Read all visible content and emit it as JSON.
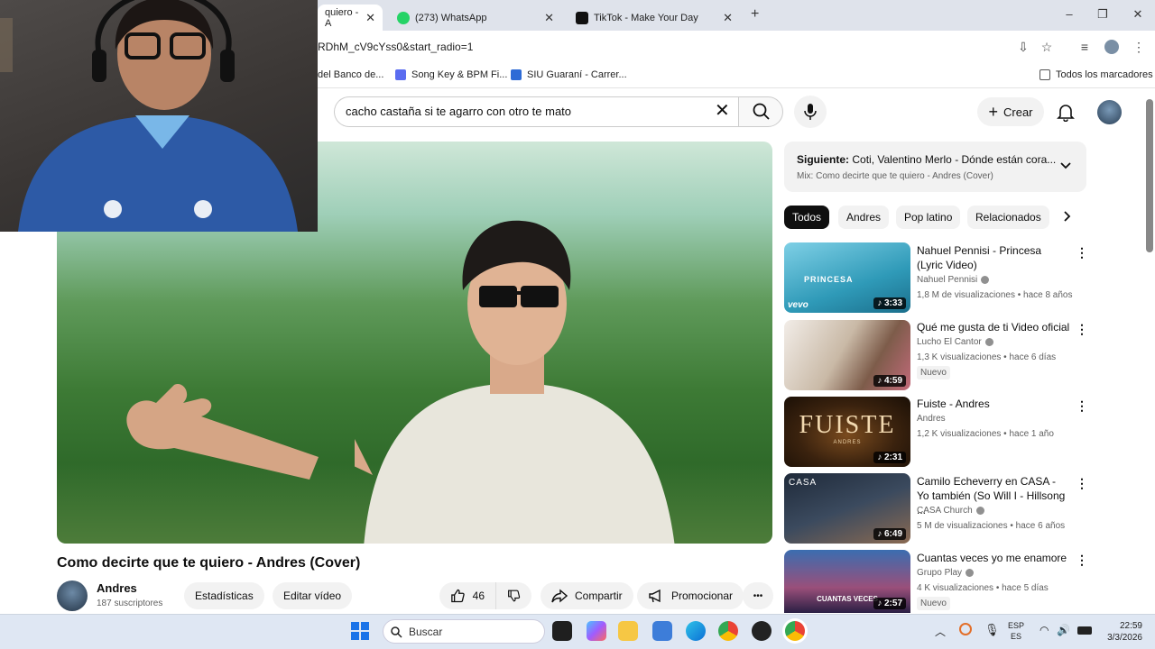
{
  "browser": {
    "tabs": [
      {
        "title": "quiero - A",
        "active": true
      },
      {
        "title": "(273) WhatsApp"
      },
      {
        "title": "TikTok - Make Your Day"
      }
    ],
    "new_tab": "+",
    "window_controls": {
      "minimize": "–",
      "maximize": "❐",
      "close": "✕"
    },
    "url": "RDhM_cV9cYss0&start_radio=1",
    "bookmarks": [
      "del Banco de...",
      "Song Key & BPM Fi...",
      "SIU Guaraní - Carrer..."
    ],
    "all_bookmarks": "Todos los marcadores"
  },
  "youtube": {
    "search_query": "cacho castaña si te agarro con otro te mato",
    "create_label": "Crear",
    "video": {
      "title": "Como decirte que te quiero - Andres (Cover)",
      "channel": "Andres",
      "subscribers": "187 suscriptores",
      "stats_label": "Estadísticas",
      "edit_label": "Editar vídeo",
      "likes": "46",
      "share_label": "Compartir",
      "promote_label": "Promocionar",
      "more_label": "•••"
    },
    "up_next": {
      "label": "Siguiente:",
      "title": "Coti, Valentino Merlo - Dónde están cora...",
      "mix": "Mix: Como decirte que te quiero - Andres (Cover)"
    },
    "chips": [
      "Todos",
      "Andres",
      "Pop latino",
      "Relacionados"
    ],
    "related": [
      {
        "title": "Nahuel Pennisi - Princesa (Lyric Video)",
        "channel": "Nahuel Pennisi",
        "meta": "1,8 M de visualizaciones • hace 8 años",
        "duration": "3:33",
        "thumb_text": "PRINCESA",
        "thumb_logo": "vevo"
      },
      {
        "title": "Qué me gusta de ti Video oficial",
        "channel": "Lucho El Cantor",
        "meta": "1,3 K visualizaciones • hace 6 días",
        "duration": "4:59",
        "badge": "Nuevo"
      },
      {
        "title": "Fuiste - Andres",
        "channel": "Andres",
        "meta": "1,2 K visualizaciones • hace 1 año",
        "duration": "2:31",
        "thumb_text": "FUISTE",
        "thumb_sub": "ANDRES"
      },
      {
        "title": "Camilo Echeverry en CASA - Yo también (So Will I - Hillsong ...",
        "channel": "CASA Church",
        "meta": "5 M de visualizaciones • hace 6 años",
        "duration": "6:49",
        "thumb_text": "CASA"
      },
      {
        "title": "Cuantas veces yo me enamore",
        "channel": "Grupo Play",
        "meta": "4 K visualizaciones • hace 5 días",
        "duration": "2:57",
        "badge": "Nuevo",
        "thumb_text": "CUANTAS VECES"
      }
    ]
  },
  "taskbar": {
    "search_placeholder": "Buscar",
    "lang": "ESP",
    "lang_sub": "ES",
    "time": "22:59",
    "date": "3/3/2026"
  },
  "colors": {
    "youtube_red": "#ff0000",
    "chip_selected": "#0f0f0f",
    "tabstrip": "#dfe3eb"
  }
}
